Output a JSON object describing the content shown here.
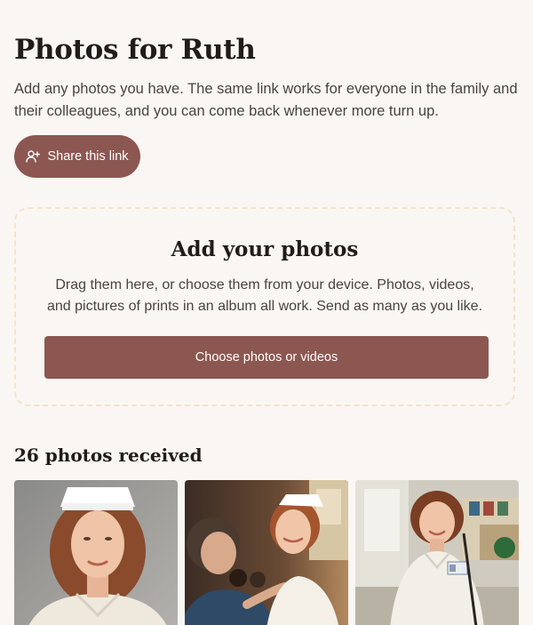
{
  "header": {
    "title": "Photos for Ruth",
    "intro": "Add any photos you have. The same link works for everyone in the family and their colleagues, and you can come back whenever more turn up.",
    "share_label": "Share this link",
    "share_icon": "add-person-icon"
  },
  "upload": {
    "title": "Add your photos",
    "description": "Drag them here, or choose them from your device. Photos, videos, and pictures of prints in an album all work. Send as many as you like.",
    "button_label": "Choose photos or videos"
  },
  "gallery": {
    "count_label": "26 photos received",
    "photos": [
      {
        "subject": "portrait of nurse in white cap"
      },
      {
        "subject": "nurse receiving pin at ceremony"
      },
      {
        "subject": "nurse with ID badge in hospital lobby"
      }
    ]
  },
  "colors": {
    "accent": "#8c5751",
    "background": "#faf6f3",
    "dropzone_border": "#f3e3c8"
  }
}
